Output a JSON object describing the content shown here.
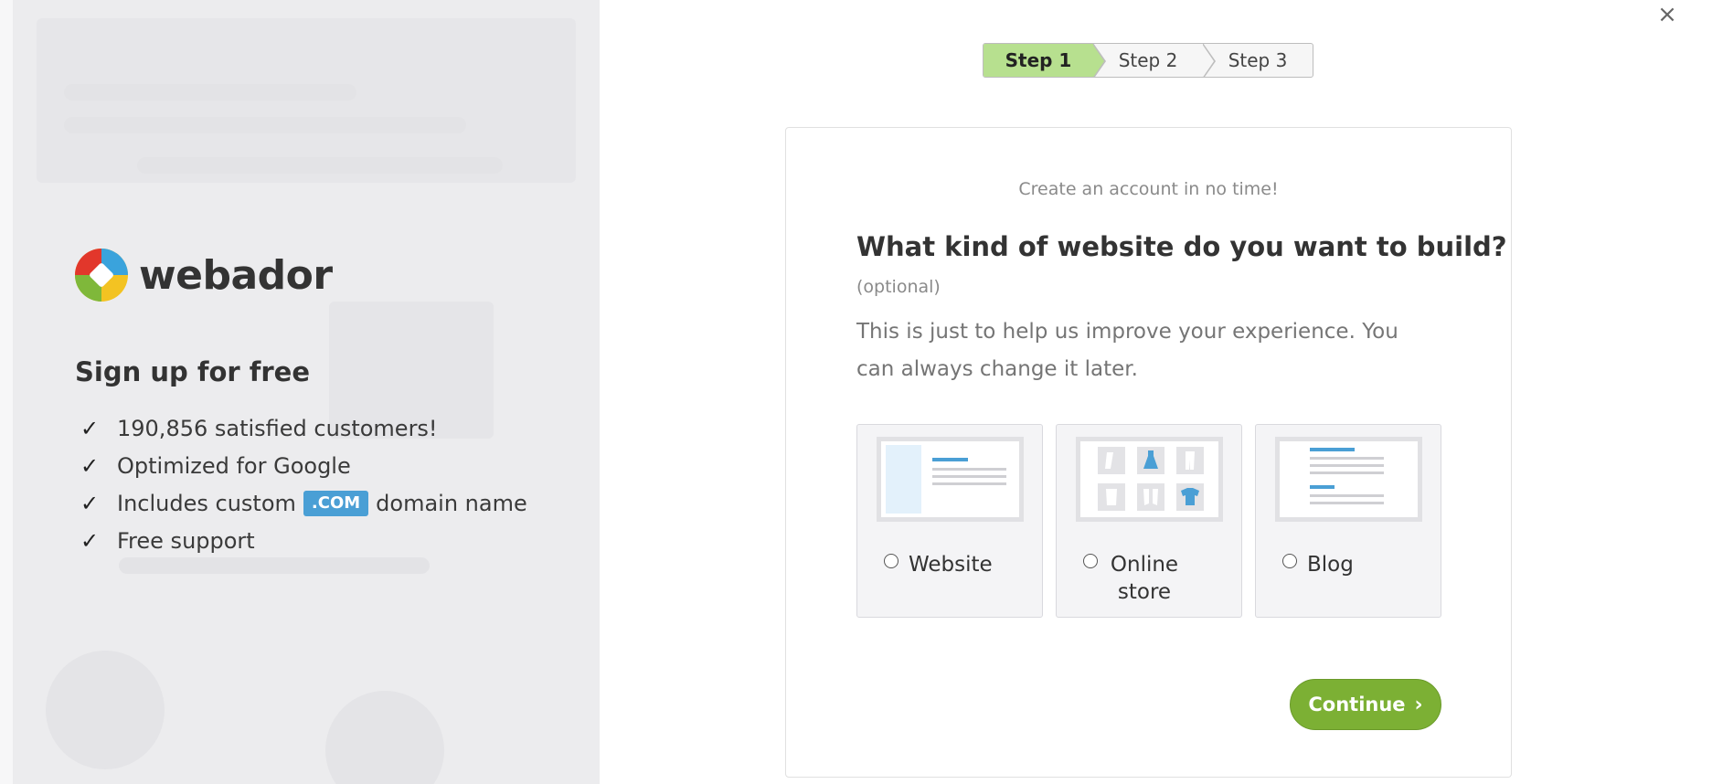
{
  "brand": {
    "name": "webador"
  },
  "left": {
    "signup_title": "Sign up for free",
    "benefits": [
      {
        "text": "190,856 satisfied customers!"
      },
      {
        "text": "Optimized for Google"
      },
      {
        "before": "Includes custom",
        "badge": ".COM",
        "after": "domain name"
      },
      {
        "text": "Free support"
      }
    ]
  },
  "close": {
    "label": "×"
  },
  "steps": [
    {
      "label": "Step 1",
      "active": true
    },
    {
      "label": "Step 2",
      "active": false
    },
    {
      "label": "Step 3",
      "active": false
    }
  ],
  "card": {
    "kicker": "Create an account in no time!",
    "title": "What kind of website do you want to build?",
    "optional": "(optional)",
    "description": "This is just to help us improve your experience. You can always change it later.",
    "options": [
      {
        "label": "Website",
        "icon": "website-layout-icon"
      },
      {
        "label": "Online store",
        "icon": "store-grid-icon"
      },
      {
        "label": "Blog",
        "icon": "blog-lines-icon"
      }
    ],
    "continue_label": "Continue",
    "continue_icon": "›"
  },
  "colors": {
    "accent_green": "#7cb034",
    "step_active": "#b7e08f",
    "badge_blue": "#4a9fd5",
    "illus_blue": "#4a9fd5"
  }
}
